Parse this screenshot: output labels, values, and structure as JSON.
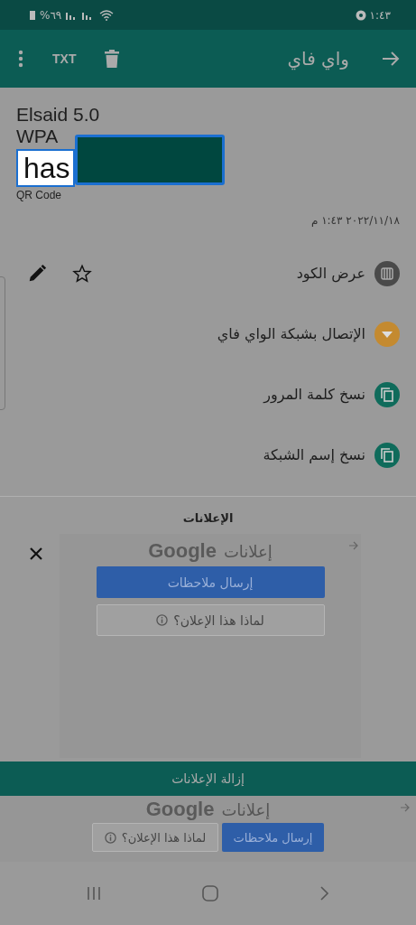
{
  "status_bar": {
    "battery": "%٦٩",
    "time": "١:٤٣"
  },
  "toolbar": {
    "title": "واي فاي",
    "export_label": "TXT"
  },
  "record": {
    "name": "Elsaid 5.0",
    "security": "WPA",
    "password": "has",
    "format": "QR Code",
    "date": "٢٠٢٢/١١/١٨ ١:٤٣ م"
  },
  "actions": [
    {
      "label": "عرض الكود",
      "kind": "code",
      "color": "#4a4a4a"
    },
    {
      "label": "الإتصال بشبكة الواي فاي",
      "kind": "wifi",
      "color": "#c48a30"
    },
    {
      "label": "نسخ كلمة المرور",
      "kind": "copy",
      "color": "#0f6b5b"
    },
    {
      "label": "نسخ إسم الشبكة",
      "kind": "copy",
      "color": "#0f6b5b"
    }
  ],
  "ad": {
    "heading": "الإعلانات",
    "label": "إعلانات",
    "brand": "Google",
    "feedback": "إرسال ملاحظات",
    "why": "لماذا هذا الإعلان؟"
  },
  "remove_ads": "إزالة الإعلانات",
  "banner": {
    "label": "إعلانات",
    "brand": "Google",
    "feedback": "إرسال ملاحظات",
    "why": "لماذا هذا الإعلان؟"
  }
}
